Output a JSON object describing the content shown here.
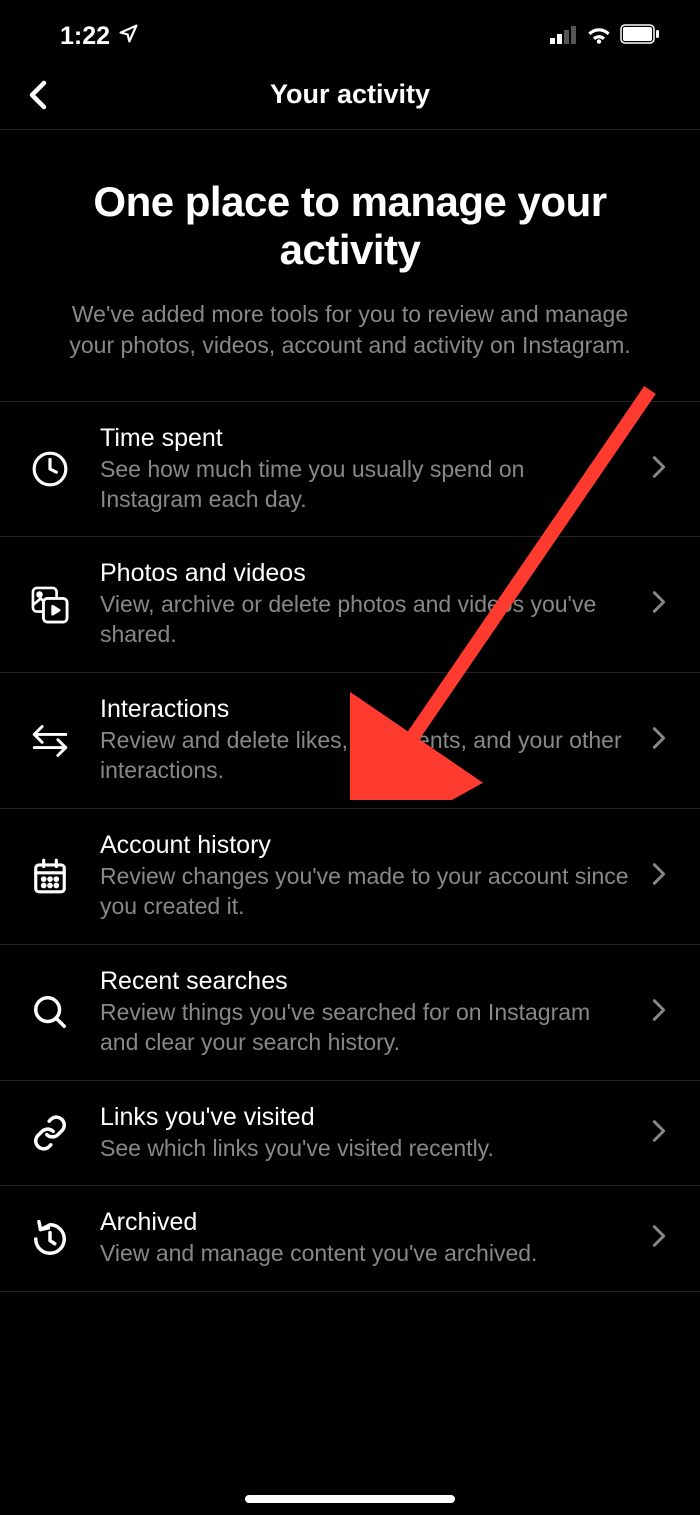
{
  "status": {
    "time": "1:22"
  },
  "header": {
    "title": "Your activity"
  },
  "hero": {
    "title": "One place to manage your activity",
    "subtitle": "We've added more tools for you to review and manage your photos, videos, account and activity on Instagram."
  },
  "items": [
    {
      "title": "Time spent",
      "desc": "See how much time you usually spend on Instagram each day."
    },
    {
      "title": "Photos and videos",
      "desc": "View, archive or delete photos and videos you've shared."
    },
    {
      "title": "Interactions",
      "desc": "Review and delete likes, comments, and your other interactions."
    },
    {
      "title": "Account history",
      "desc": "Review changes you've made to your account since you created it."
    },
    {
      "title": "Recent searches",
      "desc": "Review things you've searched for on Instagram and clear your search history."
    },
    {
      "title": "Links you've visited",
      "desc": "See which links you've visited recently."
    },
    {
      "title": "Archived",
      "desc": "View and manage content you've archived."
    }
  ]
}
